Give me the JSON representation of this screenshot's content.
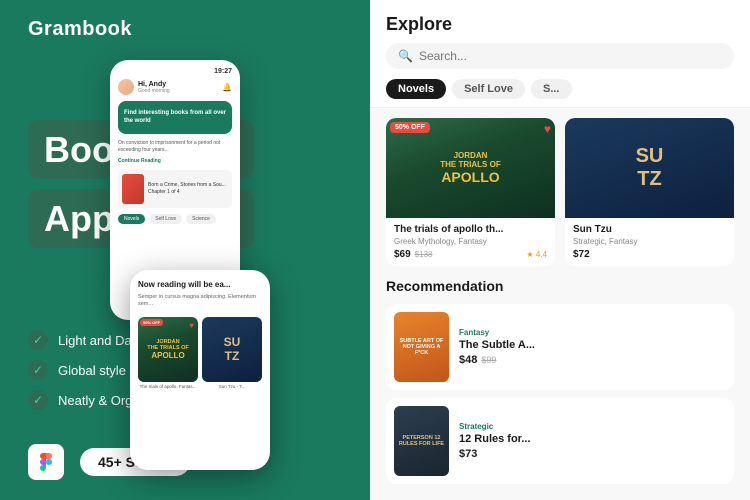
{
  "app": {
    "name": "Grambook",
    "tagline": "Book Store App UI Kits",
    "line1": "Book Store",
    "line2": "App UI Kits",
    "screens_badge": "45+ Screen",
    "features": [
      "Light and Dark Theme",
      "Global style guide",
      "Neatly & Organized Layer"
    ]
  },
  "phone_left": {
    "time": "19:27",
    "greeting": "Hi, Andy",
    "sub": "Good morning",
    "banner_text": "Find interesting books from all over the world",
    "excerpt": "On conviction to imprisonment for a period not exceeding four years...",
    "continue": "Continue Reading",
    "book_title": "Born a Crime, Stories from a Sou...",
    "book_chapter": "Chapter 1 of 4",
    "tabs": [
      "Novels",
      "Self Love",
      "Science"
    ]
  },
  "phone_bottom": {
    "reading_title": "Now reading will be ea...",
    "reading_sub": "Semper in cursus magna adipiscing. Elementum sem...",
    "book1": {
      "discount": "50% OFF",
      "title": "JORDAN\nTHE TRIALS OF\nAPOLLO"
    },
    "book2": {
      "title": "SU\nTZ"
    },
    "label1": "The trials of apollo, Fantas...",
    "label2": "Sun Tzu - T..."
  },
  "explore": {
    "title": "Explore",
    "search_placeholder": "Search...",
    "filter_tabs": [
      {
        "label": "Novels",
        "active": true
      },
      {
        "label": "Self Love",
        "active": false
      },
      {
        "label": "S...",
        "active": false
      }
    ],
    "books": [
      {
        "title": "The trials of apollo th...",
        "genre": "Greek Mythology, Fantasy",
        "price": "$69",
        "old_price": "$138",
        "rating": "★ 4.4",
        "discount": "50% OFF"
      },
      {
        "title": "Sun Tzu",
        "genre": "Strategic, Fantasy",
        "price": "$72",
        "old_price": ""
      }
    ],
    "recommendation_title": "Recommendation",
    "recommendations": [
      {
        "category": "Fantasy",
        "title": "The Subtle A...",
        "price": "$48",
        "old_price": "$99",
        "cover_text": "SUBTLE\nART OF\nNOT\nGIVING\nA F*CK"
      },
      {
        "category": "Strategic",
        "title": "12 Rules for...",
        "price": "$73",
        "old_price": "",
        "cover_text": "PETERSON\n12 RULES\nFOR LIFE"
      }
    ]
  },
  "colors": {
    "brand_green": "#1a7a5e",
    "dark_green_card": "#2d6b54",
    "accent_red": "#e74c3c",
    "text_dark": "#1a1a1a",
    "text_muted": "#888888"
  }
}
